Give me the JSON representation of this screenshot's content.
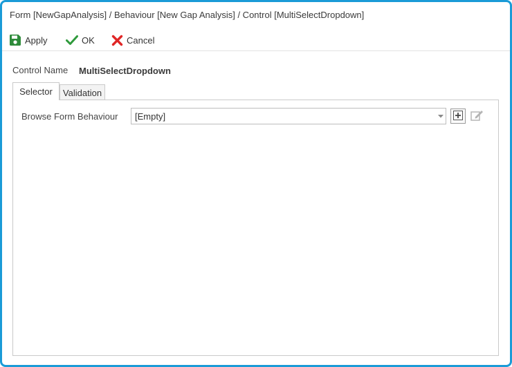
{
  "window": {
    "title": "Form [NewGapAnalysis] / Behaviour [New Gap Analysis] / Control [MultiSelectDropdown]"
  },
  "toolbar": {
    "apply_label": "Apply",
    "ok_label": "OK",
    "cancel_label": "Cancel"
  },
  "control_name": {
    "label": "Control Name",
    "value": "MultiSelectDropdown"
  },
  "tabs": [
    {
      "label": "Selector",
      "active": true
    },
    {
      "label": "Validation",
      "active": false
    }
  ],
  "selector": {
    "browse_label": "Browse Form Behaviour",
    "browse_value": "[Empty]"
  },
  "icons": {
    "apply": "save-icon",
    "ok": "check-icon",
    "cancel": "x-icon",
    "dropdown": "chevron-down-icon",
    "add": "add-icon",
    "edit": "edit-icon"
  },
  "colors": {
    "frame_border": "#1a9bd7",
    "apply_icon": "#2e8b3a",
    "ok_icon": "#2f9a3c",
    "cancel_icon": "#e02626"
  }
}
